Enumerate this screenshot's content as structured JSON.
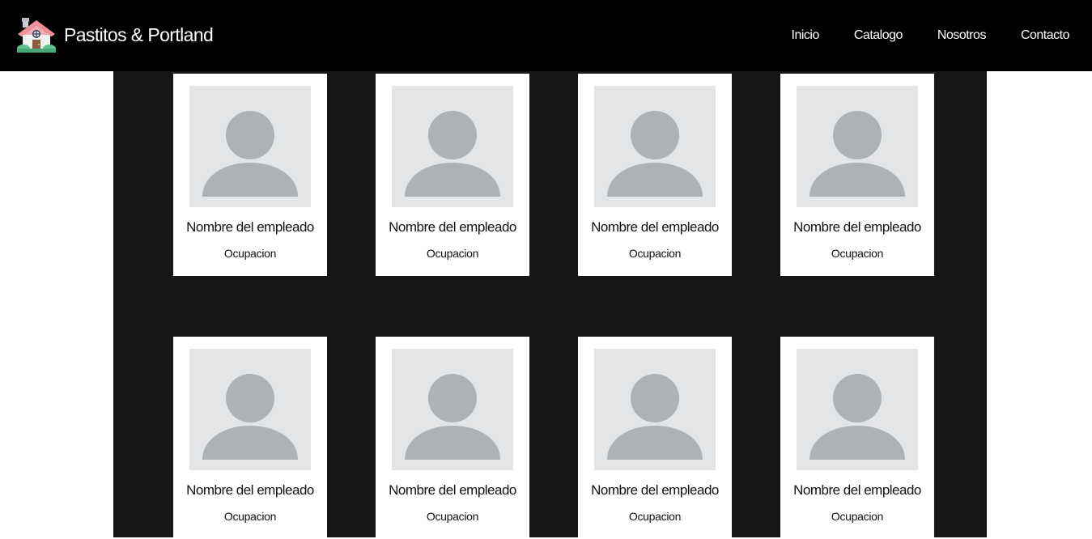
{
  "brand": {
    "name": "Pastitos & Portland",
    "logo_icon": "house-icon"
  },
  "nav": {
    "items": [
      {
        "label": "Inicio"
      },
      {
        "label": "Catalogo"
      },
      {
        "label": "Nosotros"
      },
      {
        "label": "Contacto"
      }
    ]
  },
  "colors": {
    "navbar_bg": "#000000",
    "section_bg": "#161616",
    "card_bg": "#ffffff",
    "avatar_bg": "#e4e5e7",
    "avatar_fg": "#adb2b6"
  },
  "team": {
    "placeholder_icon": "user-avatar-icon",
    "members": [
      {
        "name": "Nombre del empleado",
        "role": "Ocupacion"
      },
      {
        "name": "Nombre del empleado",
        "role": "Ocupacion"
      },
      {
        "name": "Nombre del empleado",
        "role": "Ocupacion"
      },
      {
        "name": "Nombre del empleado",
        "role": "Ocupacion"
      },
      {
        "name": "Nombre del empleado",
        "role": "Ocupacion"
      },
      {
        "name": "Nombre del empleado",
        "role": "Ocupacion"
      },
      {
        "name": "Nombre del empleado",
        "role": "Ocupacion"
      },
      {
        "name": "Nombre del empleado",
        "role": "Ocupacion"
      }
    ]
  }
}
